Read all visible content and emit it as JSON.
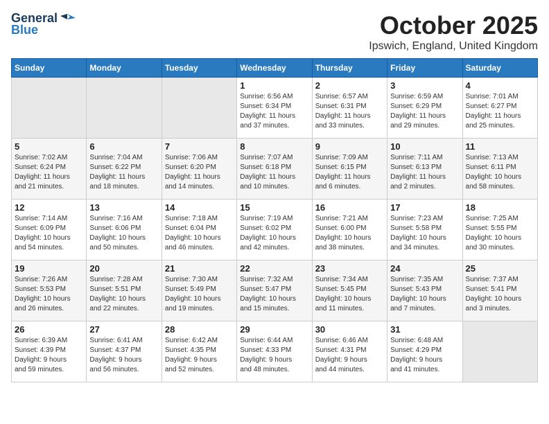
{
  "logo": {
    "general": "General",
    "blue": "Blue"
  },
  "title": "October 2025",
  "location": "Ipswich, England, United Kingdom",
  "weekdays": [
    "Sunday",
    "Monday",
    "Tuesday",
    "Wednesday",
    "Thursday",
    "Friday",
    "Saturday"
  ],
  "weeks": [
    [
      {
        "day": "",
        "info": ""
      },
      {
        "day": "",
        "info": ""
      },
      {
        "day": "",
        "info": ""
      },
      {
        "day": "1",
        "info": "Sunrise: 6:56 AM\nSunset: 6:34 PM\nDaylight: 11 hours\nand 37 minutes."
      },
      {
        "day": "2",
        "info": "Sunrise: 6:57 AM\nSunset: 6:31 PM\nDaylight: 11 hours\nand 33 minutes."
      },
      {
        "day": "3",
        "info": "Sunrise: 6:59 AM\nSunset: 6:29 PM\nDaylight: 11 hours\nand 29 minutes."
      },
      {
        "day": "4",
        "info": "Sunrise: 7:01 AM\nSunset: 6:27 PM\nDaylight: 11 hours\nand 25 minutes."
      }
    ],
    [
      {
        "day": "5",
        "info": "Sunrise: 7:02 AM\nSunset: 6:24 PM\nDaylight: 11 hours\nand 21 minutes."
      },
      {
        "day": "6",
        "info": "Sunrise: 7:04 AM\nSunset: 6:22 PM\nDaylight: 11 hours\nand 18 minutes."
      },
      {
        "day": "7",
        "info": "Sunrise: 7:06 AM\nSunset: 6:20 PM\nDaylight: 11 hours\nand 14 minutes."
      },
      {
        "day": "8",
        "info": "Sunrise: 7:07 AM\nSunset: 6:18 PM\nDaylight: 11 hours\nand 10 minutes."
      },
      {
        "day": "9",
        "info": "Sunrise: 7:09 AM\nSunset: 6:15 PM\nDaylight: 11 hours\nand 6 minutes."
      },
      {
        "day": "10",
        "info": "Sunrise: 7:11 AM\nSunset: 6:13 PM\nDaylight: 11 hours\nand 2 minutes."
      },
      {
        "day": "11",
        "info": "Sunrise: 7:13 AM\nSunset: 6:11 PM\nDaylight: 10 hours\nand 58 minutes."
      }
    ],
    [
      {
        "day": "12",
        "info": "Sunrise: 7:14 AM\nSunset: 6:09 PM\nDaylight: 10 hours\nand 54 minutes."
      },
      {
        "day": "13",
        "info": "Sunrise: 7:16 AM\nSunset: 6:06 PM\nDaylight: 10 hours\nand 50 minutes."
      },
      {
        "day": "14",
        "info": "Sunrise: 7:18 AM\nSunset: 6:04 PM\nDaylight: 10 hours\nand 46 minutes."
      },
      {
        "day": "15",
        "info": "Sunrise: 7:19 AM\nSunset: 6:02 PM\nDaylight: 10 hours\nand 42 minutes."
      },
      {
        "day": "16",
        "info": "Sunrise: 7:21 AM\nSunset: 6:00 PM\nDaylight: 10 hours\nand 38 minutes."
      },
      {
        "day": "17",
        "info": "Sunrise: 7:23 AM\nSunset: 5:58 PM\nDaylight: 10 hours\nand 34 minutes."
      },
      {
        "day": "18",
        "info": "Sunrise: 7:25 AM\nSunset: 5:55 PM\nDaylight: 10 hours\nand 30 minutes."
      }
    ],
    [
      {
        "day": "19",
        "info": "Sunrise: 7:26 AM\nSunset: 5:53 PM\nDaylight: 10 hours\nand 26 minutes."
      },
      {
        "day": "20",
        "info": "Sunrise: 7:28 AM\nSunset: 5:51 PM\nDaylight: 10 hours\nand 22 minutes."
      },
      {
        "day": "21",
        "info": "Sunrise: 7:30 AM\nSunset: 5:49 PM\nDaylight: 10 hours\nand 19 minutes."
      },
      {
        "day": "22",
        "info": "Sunrise: 7:32 AM\nSunset: 5:47 PM\nDaylight: 10 hours\nand 15 minutes."
      },
      {
        "day": "23",
        "info": "Sunrise: 7:34 AM\nSunset: 5:45 PM\nDaylight: 10 hours\nand 11 minutes."
      },
      {
        "day": "24",
        "info": "Sunrise: 7:35 AM\nSunset: 5:43 PM\nDaylight: 10 hours\nand 7 minutes."
      },
      {
        "day": "25",
        "info": "Sunrise: 7:37 AM\nSunset: 5:41 PM\nDaylight: 10 hours\nand 3 minutes."
      }
    ],
    [
      {
        "day": "26",
        "info": "Sunrise: 6:39 AM\nSunset: 4:39 PM\nDaylight: 9 hours\nand 59 minutes."
      },
      {
        "day": "27",
        "info": "Sunrise: 6:41 AM\nSunset: 4:37 PM\nDaylight: 9 hours\nand 56 minutes."
      },
      {
        "day": "28",
        "info": "Sunrise: 6:42 AM\nSunset: 4:35 PM\nDaylight: 9 hours\nand 52 minutes."
      },
      {
        "day": "29",
        "info": "Sunrise: 6:44 AM\nSunset: 4:33 PM\nDaylight: 9 hours\nand 48 minutes."
      },
      {
        "day": "30",
        "info": "Sunrise: 6:46 AM\nSunset: 4:31 PM\nDaylight: 9 hours\nand 44 minutes."
      },
      {
        "day": "31",
        "info": "Sunrise: 6:48 AM\nSunset: 4:29 PM\nDaylight: 9 hours\nand 41 minutes."
      },
      {
        "day": "",
        "info": ""
      }
    ]
  ]
}
